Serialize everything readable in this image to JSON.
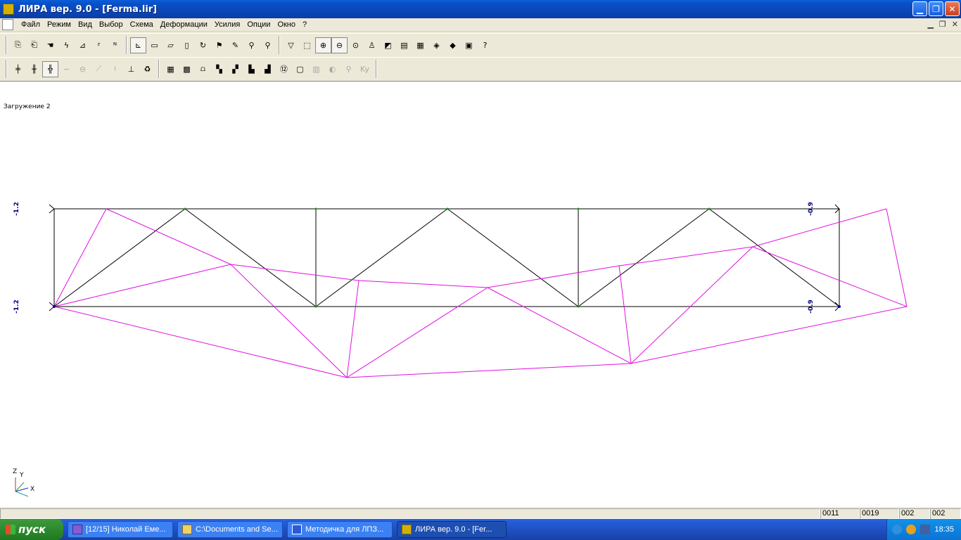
{
  "window": {
    "title": "ЛИРА  вер. 9.0 - [Ferma.lir]"
  },
  "menu": [
    "Файл",
    "Режим",
    "Вид",
    "Выбор",
    "Схема",
    "Деформации",
    "Усилия",
    "Опции",
    "Окно",
    "?"
  ],
  "toolbar1": {
    "group1": [
      "copy-icon",
      "paste-icon",
      "hand-flag-icon",
      "lightning-icon",
      "support-icon",
      "z-load-icon",
      "n-load-icon"
    ],
    "group2": [
      "axes-icon",
      "xz-view-icon",
      "xy-view-icon",
      "yz-view-icon",
      "rotate-icon",
      "flags-icon",
      "pencil-icon",
      "zoom-icon",
      "zoom-fit-icon"
    ],
    "group3": [
      "filter-icon",
      "select-nodes-icon",
      "zoom-in-icon",
      "zoom-out-icon",
      "zoom-window-icon",
      "brush-icon",
      "eraser-icon",
      "layers-icon",
      "table-icon",
      "chart-icon",
      "model-icon",
      "box-icon",
      "help-pointer-icon"
    ]
  },
  "toolbar2": {
    "group1": [
      "truss-icon",
      "truss-grid-icon",
      "truss-selected-icon",
      "curve-icon",
      "plate-icon",
      "bar-icon",
      "support-bar-icon",
      "deformed-icon",
      "refresh-icon"
    ],
    "group2": [
      "grid-icon",
      "mosaic-icon",
      "hinge-icon",
      "cells-icon",
      "cells2-icon",
      "cells-n-icon",
      "cells-nm-icon",
      "number-12-icon",
      "page-icon",
      "bars-icon",
      "diagram-icon",
      "lamp-icon",
      "ky-icon"
    ]
  },
  "canvas": {
    "load_case": "Загружение 2",
    "labels": {
      "top_left": "-1.2",
      "bottom_left": "-1.2",
      "top_right": "-0.9",
      "bottom_right": "-0.9"
    },
    "axes": {
      "z": "Z",
      "y": "Y",
      "x": "X"
    },
    "colors": {
      "original": "#000000",
      "deformed": "#e010e0",
      "label": "#000080"
    }
  },
  "status": [
    "0011",
    "0019",
    "002",
    "002"
  ],
  "taskbar": {
    "start": "пуск",
    "tasks": [
      "[12/15] Николай Еме...",
      "C:\\Documents and Se...",
      "Методичка для ЛПЗ...",
      "ЛИРА  вер. 9.0 - [Fer..."
    ],
    "clock": "18:35"
  }
}
